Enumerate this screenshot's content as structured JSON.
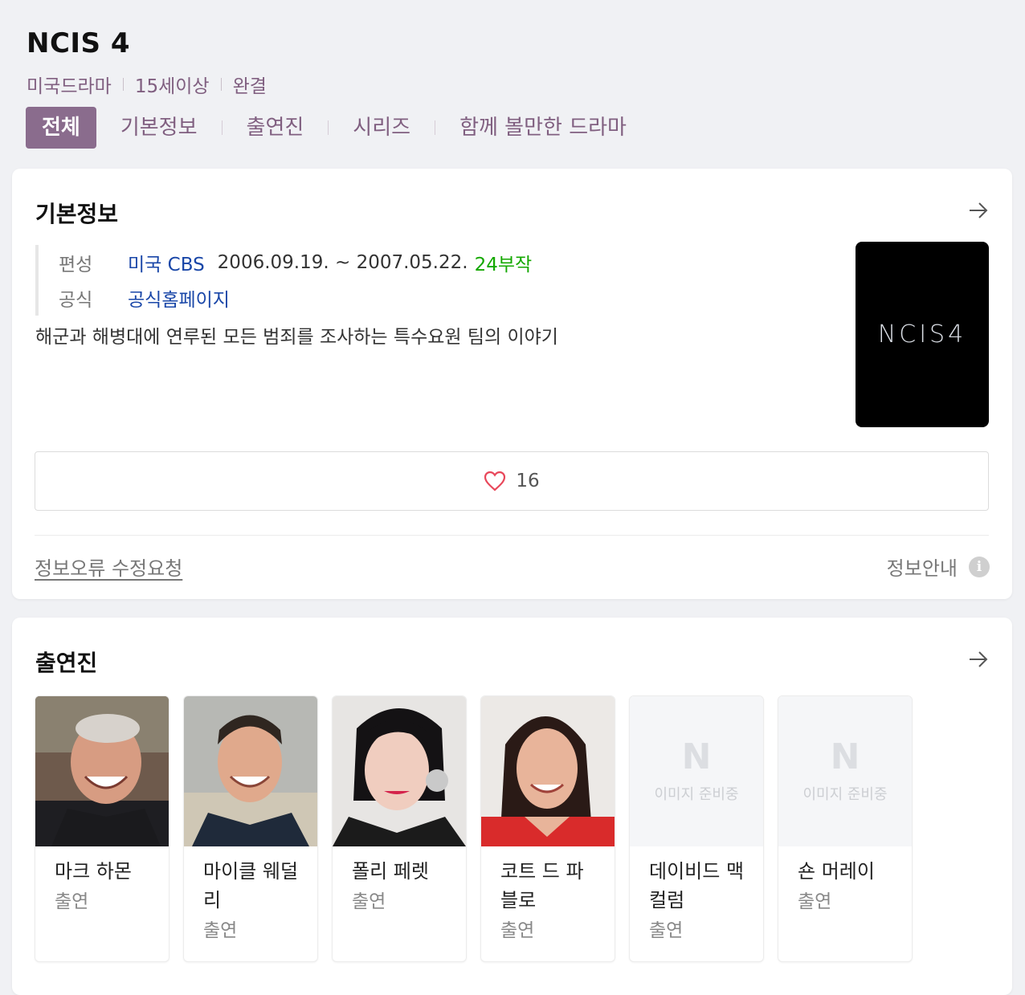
{
  "header": {
    "title": "NCIS 4",
    "meta": [
      "미국드라마",
      "15세이상",
      "완결"
    ],
    "tabs": [
      "전체",
      "기본정보",
      "출연진",
      "시리즈",
      "함께 볼만한 드라마"
    ]
  },
  "basic_info": {
    "section_title": "기본정보",
    "label_network": "편성",
    "network": "미국 CBS",
    "dates": "2006.09.19. ~ 2007.05.22.",
    "episodes": "24부작",
    "label_official": "공식",
    "official_link": "공식홈페이지",
    "description": "해군과 해병대에 연루된 모든 범죄를 조사하는 특수요원 팀의 이야기",
    "poster_text": "NCIS4",
    "likes": "16",
    "report_link": "정보오류 수정요청",
    "info_guide": "정보안내",
    "info_icon_glyph": "i"
  },
  "cast": {
    "section_title": "출연진",
    "placeholder_letter": "N",
    "placeholder_text": "이미지 준비중",
    "members": [
      {
        "name": "마크 하몬",
        "role": "출연"
      },
      {
        "name": "마이클 웨덜리",
        "role": "출연"
      },
      {
        "name": "폴리 페렛",
        "role": "출연"
      },
      {
        "name": "코트 드 파블로",
        "role": "출연"
      },
      {
        "name": "데이비드 맥컬럼",
        "role": "출연"
      },
      {
        "name": "숀 머레이",
        "role": "출연"
      }
    ]
  },
  "colors": {
    "accent": "#8a6c8d",
    "link": "#1a47a8",
    "green": "#14a800",
    "heart": "#e8475a"
  }
}
